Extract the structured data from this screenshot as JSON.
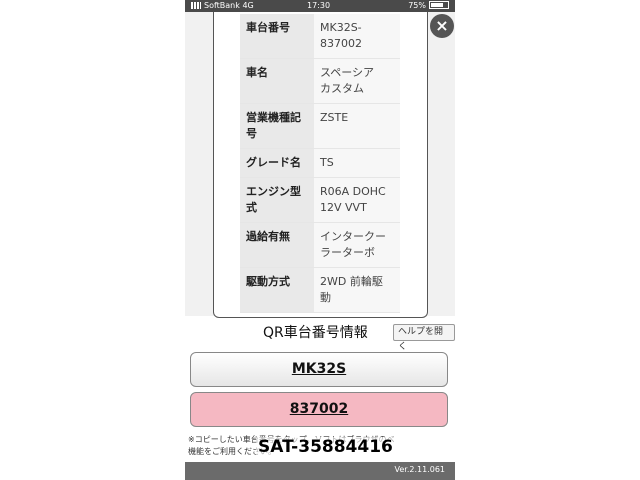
{
  "status": {
    "carrier": "SoftBank",
    "network": "4G",
    "time": "17:30",
    "battery": "75%"
  },
  "modal": {
    "close_icon": "×",
    "rows": [
      {
        "label": "車台番号",
        "value": "MK32S-\n837002"
      },
      {
        "label": "車名",
        "value": "スペーシア\nカスタム"
      },
      {
        "label": "営業機種記\n号",
        "value": "ZSTE"
      },
      {
        "label": "グレード名",
        "value": "TS"
      },
      {
        "label": "エンジン型\n式",
        "value": "R06A DOHC\n12V VVT"
      },
      {
        "label": "過給有無",
        "value": "インタークー\nラーターボ"
      },
      {
        "label": "駆動方式",
        "value": "2WD 前輪駆\n動"
      }
    ]
  },
  "qr": {
    "title": "QR車台番号情報",
    "help_label": "ヘルプを開く",
    "button1": "MK32S",
    "button2": "837002",
    "note": "※コピーしたい車台番号をタップ。ソフトはブラウザのべ\n機能をご利用ください。"
  },
  "overlay_id": "SAT-35884416",
  "version": "Ver.2.11.061",
  "colors": {
    "pink_button": "#f5b8c2",
    "status_bar": "#4a4a4a",
    "footer": "#6b6b6b"
  }
}
